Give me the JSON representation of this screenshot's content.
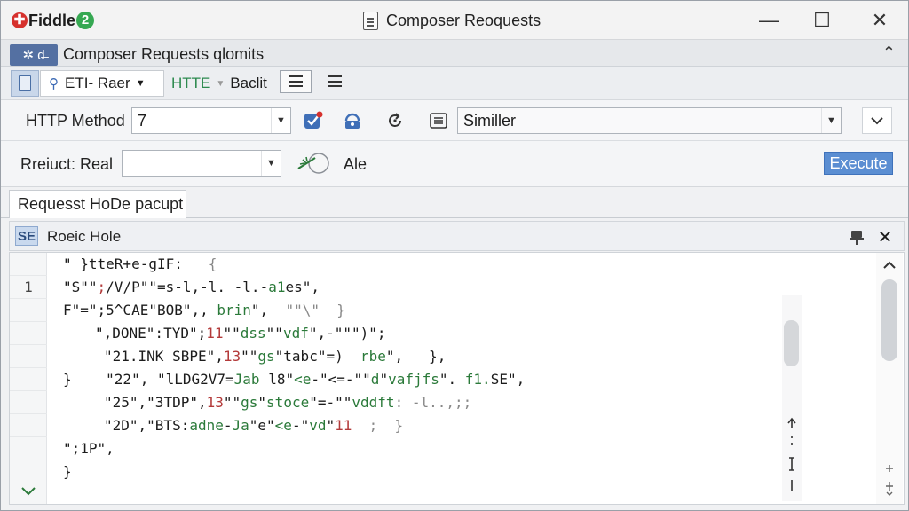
{
  "app": {
    "logo_text": "Fiddle",
    "logo_badge": "2",
    "window_title": "Composer Reoquests"
  },
  "window_controls": {
    "minimize": "—",
    "maximize": "☐",
    "close": "✕"
  },
  "doc_tab": {
    "badge": "✲ d̶",
    "label": "Composer Requests qlomits",
    "collapse": "⌃"
  },
  "subtoolbar": {
    "raw_label": "ETI- Raer",
    "http_label": "HTTE",
    "edit_label": "Baclit"
  },
  "request_row": {
    "method_label": "HTTP Method",
    "method_value": "7",
    "profile_value": "Similler"
  },
  "redirect_row": {
    "label": "Rreiuct: Real",
    "input_value": "",
    "ale_label": "Ale",
    "execute_label": "Execute"
  },
  "section_tab": {
    "label": "Requesst HoDe pacupt"
  },
  "panel": {
    "badge": "SE",
    "title": "Roeic Hole"
  },
  "editor": {
    "gutter": [
      "",
      "1",
      "",
      "",
      "",
      "",
      "",
      "",
      "",
      ""
    ],
    "lines": [
      {
        "indent": 10,
        "parts": [
          {
            "t": "\" }tteR+e-gIF:   ",
            "c": "str"
          },
          {
            "t": "{",
            "c": "dim"
          }
        ]
      },
      {
        "indent": 10,
        "parts": [
          {
            "t": "\"S\"\"",
            "c": "str"
          },
          {
            "t": ";",
            "c": "red"
          },
          {
            "t": "/V/P\"\"=s-l,-l. -l.-",
            "c": "str"
          },
          {
            "t": "a1",
            "c": "grn"
          },
          {
            "t": "es\",",
            "c": "str"
          }
        ]
      },
      {
        "indent": 10,
        "parts": [
          {
            "t": "F\"=\";5^CAE\"BOB\",, ",
            "c": "str"
          },
          {
            "t": "brin",
            "c": "grn"
          },
          {
            "t": "\",  ",
            "c": "str"
          },
          {
            "t": "\"\"\\\"  }",
            "c": "dim"
          }
        ]
      },
      {
        "indent": 46,
        "parts": [
          {
            "t": "\",DONE\":TYD\";",
            "c": "str"
          },
          {
            "t": "11",
            "c": "red"
          },
          {
            "t": "\"\"",
            "c": "str"
          },
          {
            "t": "dss",
            "c": "grn"
          },
          {
            "t": "\"\"",
            "c": "str"
          },
          {
            "t": "vdf",
            "c": "grn"
          },
          {
            "t": "\",-\"\"\")\";",
            "c": "str"
          }
        ]
      },
      {
        "indent": 56,
        "parts": [
          {
            "t": "\"21.INK SBPE\",",
            "c": "str"
          },
          {
            "t": "13",
            "c": "red"
          },
          {
            "t": "\"\"",
            "c": "str"
          },
          {
            "t": "gs",
            "c": "grn"
          },
          {
            "t": "\"tabc\"=)  ",
            "c": "str"
          },
          {
            "t": "rbe",
            "c": "grn"
          },
          {
            "t": "\",   },",
            "c": "str"
          }
        ]
      },
      {
        "indent": 10,
        "parts": [
          {
            "t": "}    \"22\", \"lLDG2V7=",
            "c": "str"
          },
          {
            "t": "Jab",
            "c": "grn"
          },
          {
            "t": " l8\"",
            "c": "str"
          },
          {
            "t": "<e",
            "c": "grn"
          },
          {
            "t": "-\"<=-\"\"",
            "c": "str"
          },
          {
            "t": "d",
            "c": "grn"
          },
          {
            "t": "\"",
            "c": "str"
          },
          {
            "t": "vafjfs",
            "c": "grn"
          },
          {
            "t": "\". ",
            "c": "str"
          },
          {
            "t": "f1.",
            "c": "grn"
          },
          {
            "t": "SE\",",
            "c": "str"
          }
        ]
      },
      {
        "indent": 56,
        "parts": [
          {
            "t": "\"25\",",
            "c": "str"
          },
          {
            "t": "\"3TDP\",",
            "c": "str"
          },
          {
            "t": "13",
            "c": "red"
          },
          {
            "t": "\"\"",
            "c": "str"
          },
          {
            "t": "gs",
            "c": "grn"
          },
          {
            "t": "\"",
            "c": "str"
          },
          {
            "t": "stoce",
            "c": "grn"
          },
          {
            "t": "\"=-\"\"",
            "c": "str"
          },
          {
            "t": "vddft",
            "c": "grn"
          },
          {
            "t": ": -l..,;;",
            "c": "dim"
          }
        ]
      },
      {
        "indent": 56,
        "parts": [
          {
            "t": "\"2D\",\"BTS:",
            "c": "str"
          },
          {
            "t": "adne",
            "c": "grn"
          },
          {
            "t": "-",
            "c": "str"
          },
          {
            "t": "Ja",
            "c": "grn"
          },
          {
            "t": "\"e\"",
            "c": "str"
          },
          {
            "t": "<e",
            "c": "grn"
          },
          {
            "t": "-\"",
            "c": "str"
          },
          {
            "t": "vd",
            "c": "grn"
          },
          {
            "t": "\"",
            "c": "str"
          },
          {
            "t": "11",
            "c": "red"
          },
          {
            "t": "  ;  }",
            "c": "dim"
          }
        ]
      },
      {
        "indent": 10,
        "parts": [
          {
            "t": "\";1P\",",
            "c": "str"
          }
        ]
      },
      {
        "indent": 10,
        "parts": [
          {
            "t": "}",
            "c": "str"
          }
        ]
      }
    ]
  },
  "icons": {
    "window_doc": "document-icon",
    "raw_person": "person-icon",
    "checkbox_check": "check-icon",
    "lock": "lock-icon",
    "refresh": "refresh-icon",
    "list": "list-icon",
    "wand": "wand-icon",
    "pin": "pin-icon"
  },
  "colors": {
    "accent": "#5b8ed2",
    "logo_red": "#d6312d",
    "logo_green": "#36a852",
    "code_green": "#2b7a3a"
  }
}
